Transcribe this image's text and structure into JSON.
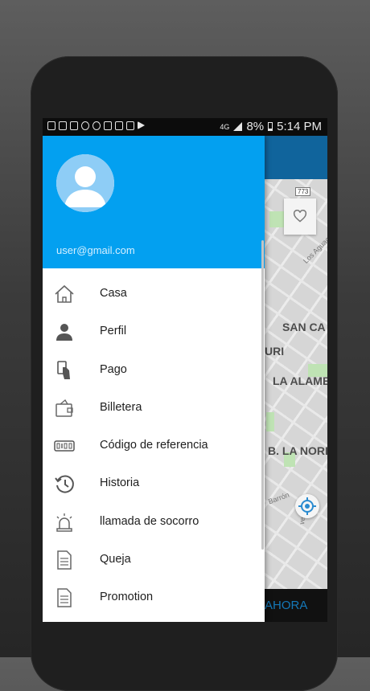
{
  "statusbar": {
    "network": "4G",
    "battery": "8%",
    "time": "5:14 PM"
  },
  "drawer": {
    "email": "user@gmail.com",
    "items": [
      {
        "label": "Casa",
        "icon": "home-icon"
      },
      {
        "label": "Perfil",
        "icon": "person-icon"
      },
      {
        "label": "Pago",
        "icon": "payment-icon"
      },
      {
        "label": "Billetera",
        "icon": "wallet-icon"
      },
      {
        "label": "Código de referencia",
        "icon": "referral-code-icon"
      },
      {
        "label": "Historia",
        "icon": "history-icon"
      },
      {
        "label": "llamada de socorro",
        "icon": "emergency-siren-icon"
      },
      {
        "label": "Queja",
        "icon": "document-icon"
      },
      {
        "label": "Promotion",
        "icon": "document-icon"
      }
    ]
  },
  "map": {
    "labels": [
      "SAN CA",
      "URI",
      "LA ALAME",
      "B. LA NORIA"
    ],
    "small_labels": [
      "Los Aguacus",
      "Barrón",
      "ve"
    ],
    "road_badge": "773"
  },
  "bottom_bar": {
    "label": "AHORA"
  },
  "colors": {
    "drawer_header": "#03a0f0",
    "appbar": "#10649c",
    "bottom_label": "#1478b8"
  }
}
